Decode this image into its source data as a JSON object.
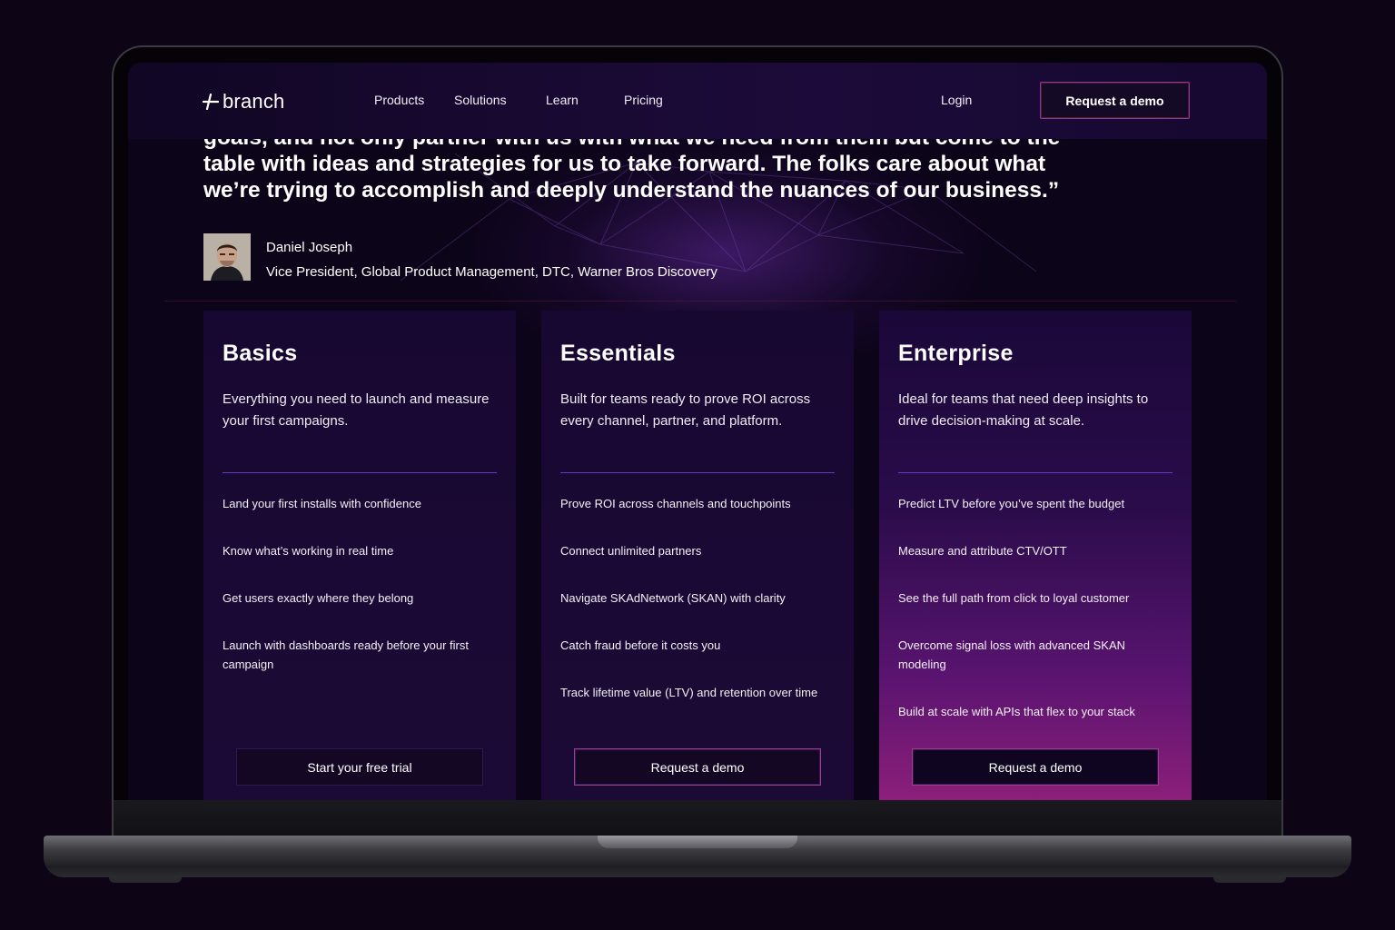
{
  "colors": {
    "background": "#0d0515",
    "accent_purple": "#6a38c8",
    "accent_magenta": "#8c1f7a"
  },
  "nav": {
    "logo_text": "branch",
    "logo_icon": "branch-logo-icon",
    "links": [
      "Products",
      "Solutions",
      "Learn",
      "Pricing"
    ],
    "login": "Login",
    "cta": "Request a demo"
  },
  "testimonial": {
    "quote_lines": [
      "goals, and not only partner with us with what we need from them but come to the",
      "table with ideas and strategies for us to take forward. The folks care about what",
      "we’re trying to accomplish and deeply understand the nuances of our business.”"
    ],
    "name": "Daniel Joseph",
    "title": "Vice President, Global Product Management, DTC, Warner Bros Discovery"
  },
  "plans": [
    {
      "name": "Basics",
      "description": "Everything you need to launch and measure your first campaigns.",
      "features": [
        "Land your first installs with confidence",
        "Know what’s working in real time",
        "Get users exactly where they belong",
        "Launch with dashboards ready before your first campaign"
      ],
      "cta": "Start your free trial"
    },
    {
      "name": "Essentials",
      "description": "Built for teams ready to prove ROI across every channel, partner, and platform.",
      "features": [
        "Prove ROI across channels and touchpoints",
        "Connect unlimited partners",
        "Navigate SKAdNetwork (SKAN) with clarity",
        "Catch fraud before it costs you",
        "Track lifetime value (LTV) and retention over time"
      ],
      "cta": "Request a demo"
    },
    {
      "name": "Enterprise",
      "description": "Ideal for teams that need deep insights to drive decision-making at scale.",
      "features": [
        "Predict LTV before you’ve spent the budget",
        "Measure and attribute CTV/OTT",
        "See the full path from click to loyal customer",
        "Overcome signal loss with advanced SKAN modeling",
        "Build at scale with APIs that flex to your stack"
      ],
      "cta": "Request a demo"
    }
  ]
}
